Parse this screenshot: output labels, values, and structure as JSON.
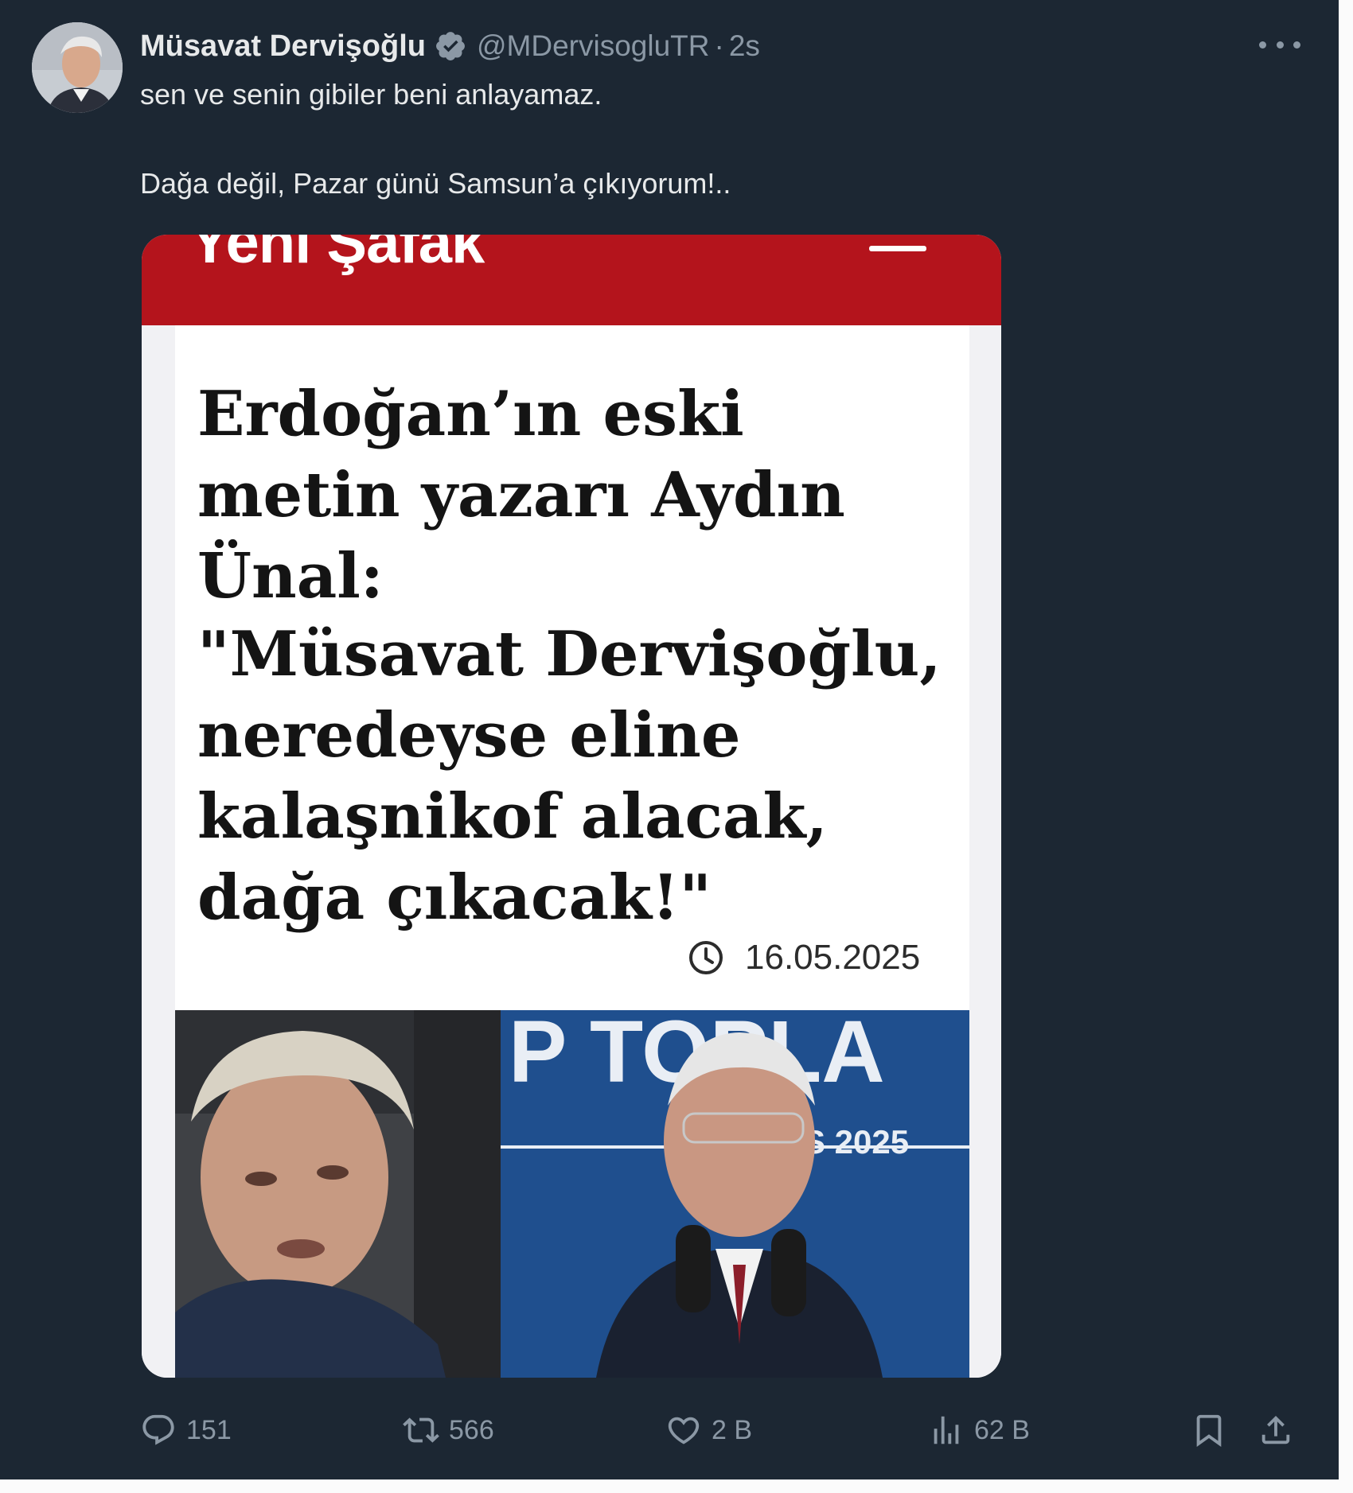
{
  "author": {
    "display_name": "Müsavat Dervişoğlu",
    "handle": "@MDervisogluTR",
    "separator": "·",
    "time": "2s",
    "verified_icon": "verified-badge-icon",
    "accent_color": "#1d9bf0"
  },
  "tweet": {
    "line1": "sen ve senin gibiler beni anlayamaz.",
    "line2": "Dağa değil, Pazar günü Samsun’a çıkıyorum!.."
  },
  "media": {
    "logo": "Yeni Şafak",
    "headline": "Erdoğan’ın eski metin yazarı Aydın Ünal:",
    "quote": "\"Müsavat Dervişoğlu, neredeyse eline kalaşnikof alacak, dağa çıkacak!\"",
    "date": "16.05.2025",
    "backdrop_text_top": "P TOPLA",
    "backdrop_text_mid": "S 2025",
    "brand_color": "#b4141c"
  },
  "actions": {
    "reply_count": "151",
    "retweet_count": "566",
    "like_count": "2 B",
    "views_count": "62 B"
  }
}
